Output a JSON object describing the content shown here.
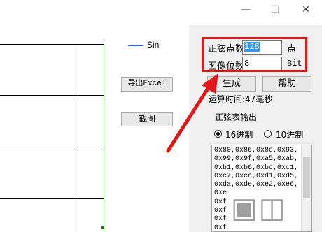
{
  "window": {
    "controls": {
      "minimize": "—",
      "maximize": "☐",
      "close": "✕"
    }
  },
  "chart": {
    "legend_label": "Sin"
  },
  "buttons": {
    "export_excel": "导出Excel",
    "screenshot": "截图",
    "generate": "生成",
    "help": "帮助"
  },
  "form": {
    "points_label": "正弦点数",
    "points_value": "128",
    "points_unit": "点",
    "bits_label": "图像位数",
    "bits_value": "8",
    "bits_unit": "Bit"
  },
  "status": {
    "time_text": "运算时间:47毫秒"
  },
  "output": {
    "title": "正弦表输出",
    "radio_hex16": "16进制",
    "radio_hex10": "10进制",
    "selected": "16进制",
    "lines": [
      "0x80,0x86,0x8c,0x93,",
      "0x99,0x9f,0xa5,0xab,",
      "0xb1,0xb6,0xbc,0xc1,",
      "0xc7,0xcc,0xd1,0xd5,",
      "0xda,0xde,0xe2,0xe6,",
      "0xe",
      "0xf",
      "0xf",
      "0xf",
      "0xf",
      "0xf"
    ]
  },
  "colors": {
    "annotation_red": "#e01818",
    "selection_blue": "#3399ff",
    "legend_blue": "#2b5fd0"
  }
}
